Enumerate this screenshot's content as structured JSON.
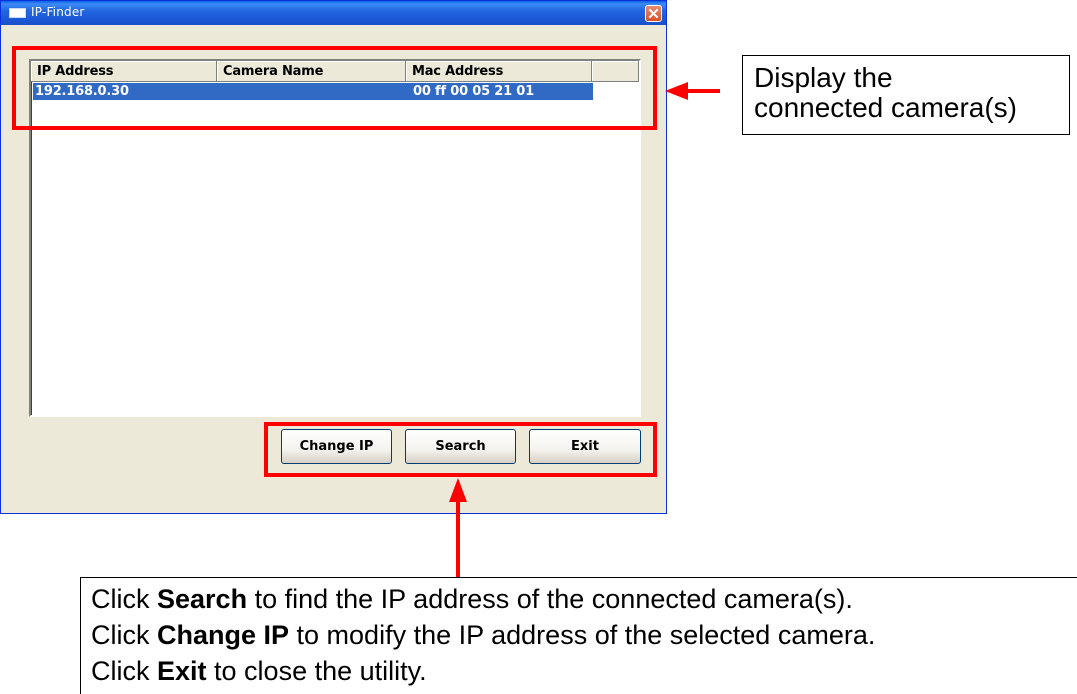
{
  "window": {
    "title": "IP-Finder"
  },
  "list": {
    "columns": [
      "IP Address",
      "Camera Name",
      "Mac Address",
      ""
    ],
    "rows": [
      {
        "ip": "192.168.0.30",
        "camera_name": "",
        "mac": "00 ff 00 05 21 01",
        "selected": true
      }
    ]
  },
  "buttons": {
    "change_ip": "Change IP",
    "search": "Search",
    "exit": "Exit"
  },
  "annotations": {
    "list_callout": {
      "line1": "Display the",
      "line2": "connected camera(s)"
    },
    "buttons_callout": {
      "line1_pre": "Click ",
      "line1_bold": "Search",
      "line1_post": " to find the IP address of the connected camera(s).",
      "line2_pre": "Click ",
      "line2_bold": "Change IP",
      "line2_post": " to modify the IP address of the selected camera.",
      "line3_pre": "Click ",
      "line3_bold": "Exit",
      "line3_post": " to close the utility."
    },
    "highlight_color": "#ff0000"
  },
  "colors": {
    "titlebar": "#1c5ad8",
    "selection": "#316ac5",
    "window_bg": "#ece9d8"
  }
}
